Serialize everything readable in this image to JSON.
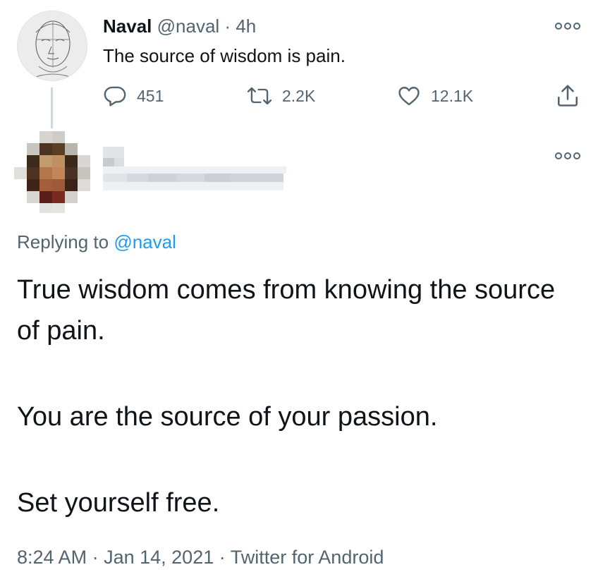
{
  "parent_tweet": {
    "author_name": "Naval",
    "author_handle": "@naval",
    "separator": "·",
    "age": "4h",
    "text": "The source of wisdom is pain.",
    "stats": {
      "replies": "451",
      "retweets": "2.2K",
      "likes": "12.1K"
    },
    "icons": [
      "reply-icon",
      "retweet-icon",
      "like-icon",
      "share-icon",
      "more-icon"
    ]
  },
  "reply_tweet": {
    "replying_prefix": "Replying to",
    "replying_handle": "@naval",
    "paragraphs": [
      "True wisdom comes from knowing the source of pain.",
      "You are the source of your passion.",
      "Set yourself free."
    ],
    "time": "8:24 AM",
    "date": "Jan 14, 2021",
    "client": "Twitter for Android",
    "separator": "·",
    "icons": [
      "more-icon"
    ]
  },
  "colors": {
    "text_primary": "#0f1419",
    "text_secondary": "#536471",
    "link_blue": "#1d9bf0",
    "thread_line": "#cfd9de"
  }
}
